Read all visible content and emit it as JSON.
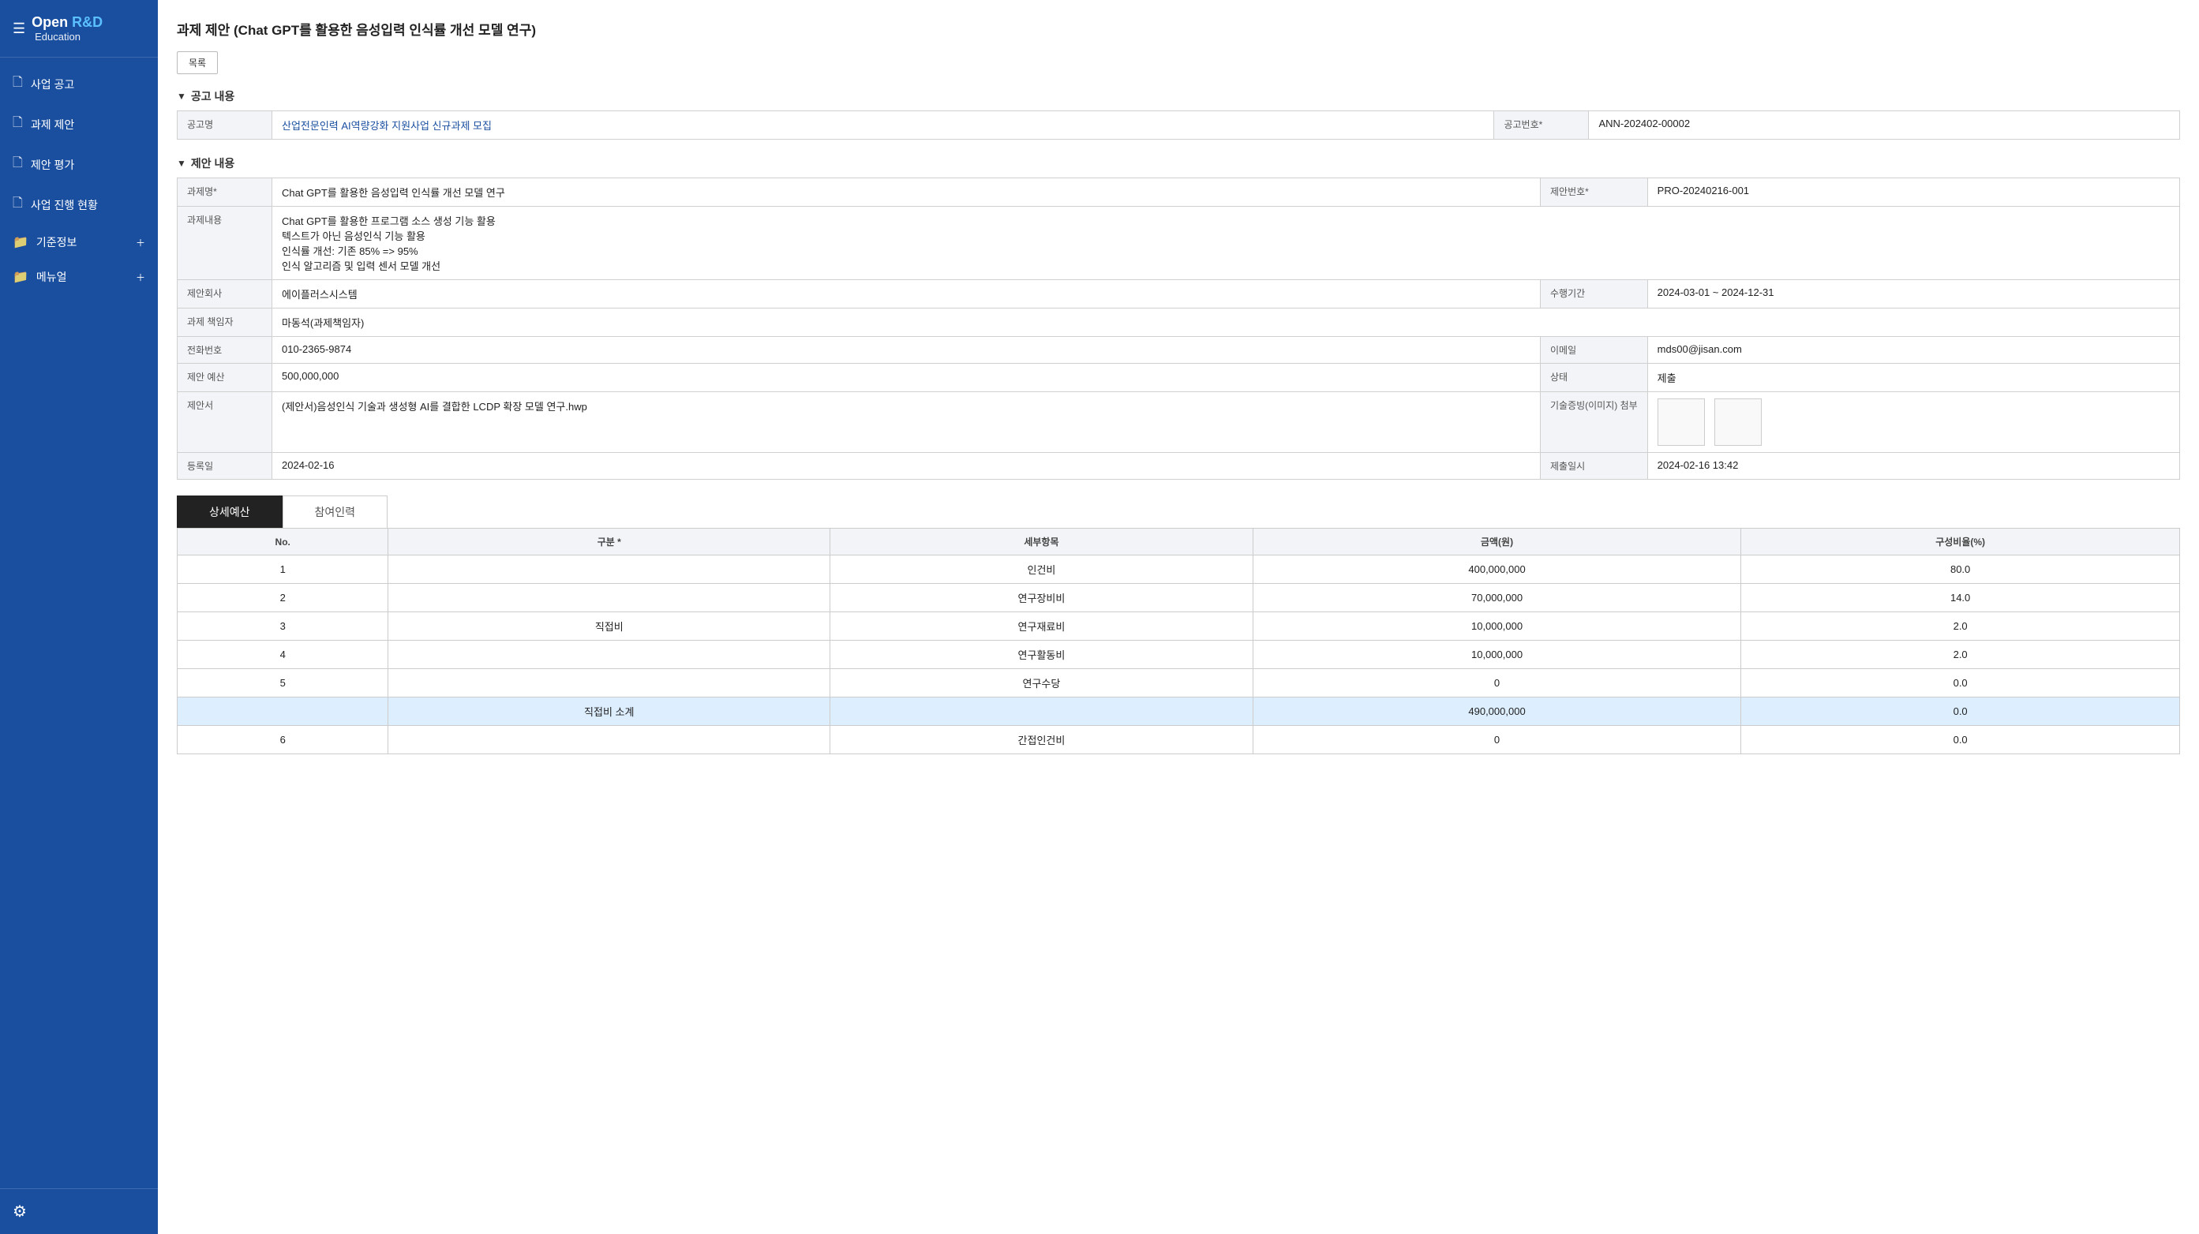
{
  "sidebar": {
    "logo": "Open R&D",
    "logo_highlight": "R&D",
    "logo_prefix": "Open ",
    "logo_sub": "Education",
    "nav_items": [
      {
        "id": "business-announcement",
        "label": "사업 공고",
        "icon": "📄",
        "expandable": false
      },
      {
        "id": "project-proposal",
        "label": "과제 제안",
        "icon": "📄",
        "expandable": false
      },
      {
        "id": "proposal-evaluation",
        "label": "제안 평가",
        "icon": "📄",
        "expandable": false
      },
      {
        "id": "business-progress",
        "label": "사업 진행 현황",
        "icon": "📄",
        "expandable": false
      },
      {
        "id": "criteria-info",
        "label": "기준정보",
        "icon": "📁",
        "expandable": true
      },
      {
        "id": "manual",
        "label": "메뉴얼",
        "icon": "📁",
        "expandable": true
      }
    ]
  },
  "page": {
    "title": "과제 제안 (Chat GPT를 활용한 음성입력 인식률 개선 모델 연구)",
    "btn_list": "목록"
  },
  "announcement_section": {
    "header": "공고 내용",
    "fields": [
      {
        "label": "공고명",
        "value": "산업전문인력 AI역량강화 지원사업 신규과제 모집",
        "is_link": true
      },
      {
        "label": "공고번호*",
        "value": "ANN-202402-00002"
      }
    ]
  },
  "proposal_section": {
    "header": "제안 내용",
    "rows": [
      {
        "cells": [
          {
            "label": "과제명*",
            "value": "Chat GPT를 활용한 음성입력 인식률 개선 모델 연구"
          },
          {
            "label": "제안번호*",
            "value": "PRO-20240216-001"
          }
        ]
      },
      {
        "cells": [
          {
            "label": "과제내용",
            "value": "Chat GPT를 활용한 프로그램 소스 생성 기능 활용\n텍스트가 아닌 음성인식 기능 활용\n인식률 개선: 기존 85% => 95%\n인식 알고리즘 및 입력 센서 모델 개선",
            "multiline": true
          }
        ]
      },
      {
        "cells": [
          {
            "label": "제안회사",
            "value": "에이플러스시스템"
          },
          {
            "label": "수행기간",
            "value": "2024-03-01  ~  2024-12-31"
          }
        ]
      },
      {
        "cells": [
          {
            "label": "과제 책임자",
            "value": "마동석(과제책임자)"
          }
        ]
      },
      {
        "cells": [
          {
            "label": "전화번호",
            "value": "010-2365-9874"
          },
          {
            "label": "이메일",
            "value": "mds00@jisan.com"
          }
        ]
      },
      {
        "cells": [
          {
            "label": "제안 예산",
            "value": "500,000,000"
          },
          {
            "label": "상태",
            "value": "제출"
          }
        ]
      },
      {
        "cells": [
          {
            "label": "제안서",
            "value": "(제안서)음성인식 기술과 생성형 AI를 결합한 LCDP 확장 모델 연구.hwp"
          },
          {
            "label": "기술증빙(이미지) 첨부",
            "value": "",
            "has_images": true
          }
        ]
      },
      {
        "cells": [
          {
            "label": "등록일",
            "value": "2024-02-16"
          },
          {
            "label": "제출일시",
            "value": "2024-02-16 13:42"
          }
        ]
      }
    ]
  },
  "tabs": [
    {
      "id": "budget-detail",
      "label": "상세예산",
      "active": true
    },
    {
      "id": "participants",
      "label": "참여인력",
      "active": false
    }
  ],
  "budget_table": {
    "headers": [
      "No.",
      "구분 *",
      "세부항목",
      "금액(원)",
      "구성비율(%)"
    ],
    "rows": [
      {
        "no": "1",
        "category": "",
        "item": "인건비",
        "amount": "400,000,000",
        "ratio": "80.0",
        "subtotal": false
      },
      {
        "no": "2",
        "category": "",
        "item": "연구장비비",
        "amount": "70,000,000",
        "ratio": "14.0",
        "subtotal": false
      },
      {
        "no": "3",
        "category": "직접비",
        "item": "연구재료비",
        "amount": "10,000,000",
        "ratio": "2.0",
        "subtotal": false
      },
      {
        "no": "4",
        "category": "",
        "item": "연구활동비",
        "amount": "10,000,000",
        "ratio": "2.0",
        "subtotal": false
      },
      {
        "no": "5",
        "category": "",
        "item": "연구수당",
        "amount": "0",
        "ratio": "0.0",
        "subtotal": false
      },
      {
        "no": "",
        "category": "직접비 소계",
        "item": "",
        "amount": "490,000,000",
        "ratio": "0.0",
        "subtotal": true
      },
      {
        "no": "6",
        "category": "",
        "item": "간접인건비",
        "amount": "0",
        "ratio": "0.0",
        "subtotal": false
      }
    ]
  }
}
